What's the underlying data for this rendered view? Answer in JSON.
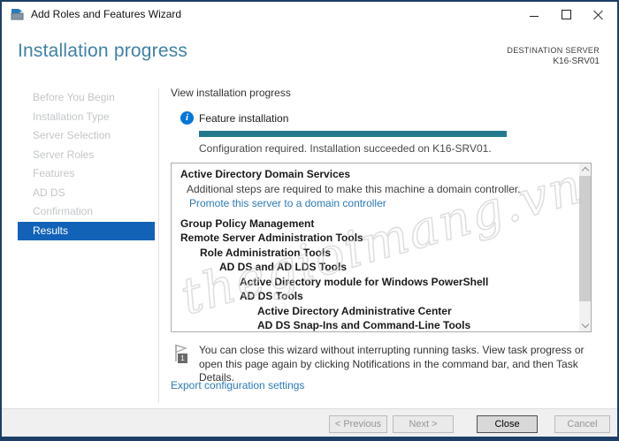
{
  "window": {
    "title": "Add Roles and Features Wizard"
  },
  "header": {
    "page_title": "Installation progress",
    "destination_label": "DESTINATION SERVER",
    "destination_server": "K16-SRV01"
  },
  "sidebar": {
    "items": [
      {
        "label": "Before You Begin",
        "state": "disabled"
      },
      {
        "label": "Installation Type",
        "state": "disabled"
      },
      {
        "label": "Server Selection",
        "state": "disabled"
      },
      {
        "label": "Server Roles",
        "state": "disabled"
      },
      {
        "label": "Features",
        "state": "disabled"
      },
      {
        "label": "AD DS",
        "state": "disabled"
      },
      {
        "label": "Confirmation",
        "state": "disabled"
      },
      {
        "label": "Results",
        "state": "selected"
      }
    ]
  },
  "main": {
    "view_label": "View installation progress",
    "install": {
      "title": "Feature installation",
      "progress_percent": 100,
      "status": "Configuration required. Installation succeeded on K16-SRV01."
    },
    "results_list": [
      {
        "text": "Active Directory Domain Services",
        "style": "bold",
        "indent": 0
      },
      {
        "text": "Additional steps are required to make this machine a domain controller.",
        "style": "normal",
        "indent": 0
      },
      {
        "text": "Promote this server to a domain controller",
        "style": "link",
        "indent": 0
      },
      {
        "text": "Group Policy Management",
        "style": "bold",
        "indent": 0
      },
      {
        "text": "Remote Server Administration Tools",
        "style": "bold",
        "indent": 0
      },
      {
        "text": "Role Administration Tools",
        "style": "bold",
        "indent": 1
      },
      {
        "text": "AD DS and AD LDS Tools",
        "style": "bold",
        "indent": 2
      },
      {
        "text": "Active Directory module for Windows PowerShell",
        "style": "bold",
        "indent": 3
      },
      {
        "text": "AD DS Tools",
        "style": "bold",
        "indent": 3
      },
      {
        "text": "Active Directory Administrative Center",
        "style": "bold",
        "indent": 4
      },
      {
        "text": "AD DS Snap-Ins and Command-Line Tools",
        "style": "bold",
        "indent": 4
      }
    ],
    "notification": {
      "badge": "1",
      "text": "You can close this wizard without interrupting running tasks. View task progress or open this page again by clicking Notifications in the command bar, and then Task Details."
    },
    "export_link": "Export configuration settings"
  },
  "footer": {
    "previous_label": "< Previous",
    "next_label": "Next >",
    "close_label": "Close",
    "cancel_label": "Cancel"
  },
  "watermark": {
    "text": "thegioimang.vn"
  },
  "icons": {
    "info_glyph": "i"
  },
  "colors": {
    "header_accent": "#3f81a5",
    "selection_blue": "#1263b8",
    "link_blue": "#2b7bb9",
    "progress_teal": "#22798e",
    "info_blue": "#0277d7",
    "window_border": "#1d3f66"
  }
}
